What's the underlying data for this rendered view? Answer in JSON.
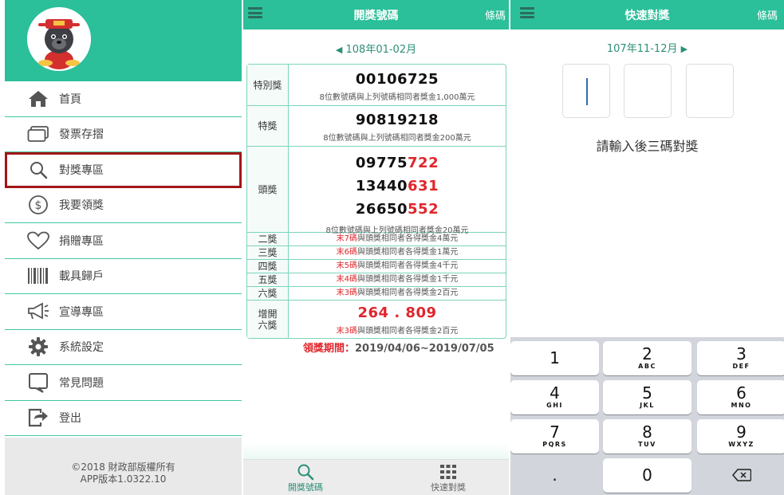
{
  "menu": {
    "items": [
      {
        "label": "首頁",
        "icon": "home-icon"
      },
      {
        "label": "發票存摺",
        "icon": "card-icon"
      },
      {
        "label": "對獎專區",
        "icon": "search-icon"
      },
      {
        "label": "我要領獎",
        "icon": "dollar-icon"
      },
      {
        "label": "捐贈專區",
        "icon": "heart-icon"
      },
      {
        "label": "載具歸戶",
        "icon": "barcode-icon"
      },
      {
        "label": "宣導專區",
        "icon": "megaphone-icon"
      },
      {
        "label": "系統設定",
        "icon": "gear-icon"
      },
      {
        "label": "常見問題",
        "icon": "question-icon"
      },
      {
        "label": "登出",
        "icon": "logout-icon"
      }
    ],
    "footer_copyright": "©2018 財政部版權所有",
    "footer_version": "APP版本1.0322.10"
  },
  "draw": {
    "title": "開獎號碼",
    "right_label": "條碼",
    "period": "108年01-02月",
    "prizes": {
      "special": {
        "label": "特別獎",
        "number": "00106725",
        "desc": "8位數號碼與上列號碼相同者獎金1,000萬元"
      },
      "grand": {
        "label": "特獎",
        "number": "90819218",
        "desc": "8位數號碼與上列號碼相同者獎金200萬元"
      },
      "first": {
        "label": "頭獎",
        "numbers": [
          {
            "head": "09775",
            "tail": "722"
          },
          {
            "head": "13440",
            "tail": "631"
          },
          {
            "head": "26650",
            "tail": "552"
          }
        ],
        "desc": "8位數號碼與上列號碼相同者獎金20萬元"
      },
      "lower": [
        {
          "label": "二獎",
          "red": "末7碼",
          "rest": "與頭獎相同者各得獎金4萬元"
        },
        {
          "label": "三獎",
          "red": "末6碼",
          "rest": "與頭獎相同者各得獎金1萬元"
        },
        {
          "label": "四獎",
          "red": "末5碼",
          "rest": "與頭獎相同者各得獎金4千元"
        },
        {
          "label": "五獎",
          "red": "末4碼",
          "rest": "與頭獎相同者各得獎金1千元"
        },
        {
          "label": "六獎",
          "red": "末3碼",
          "rest": "與頭獎相同者各得獎金2百元"
        }
      ],
      "extra": {
        "label_line1": "增開",
        "label_line2": "六獎",
        "numbers": "264 . 809",
        "red": "末3碼",
        "rest": "與頭獎相同者各得獎金2百元"
      }
    },
    "claim_label": "領獎期間：",
    "claim_period": "2019/04/06~2019/07/05",
    "nav": {
      "draw_label": "開獎號碼",
      "quick_label": "快速對獎"
    }
  },
  "quick": {
    "title": "快速對獎",
    "right_label": "條碼",
    "period": "107年11-12月",
    "prompt": "請輸入後三碼對獎",
    "keys": [
      {
        "num": "1",
        "letters": ""
      },
      {
        "num": "2",
        "letters": "ABC"
      },
      {
        "num": "3",
        "letters": "DEF"
      },
      {
        "num": "4",
        "letters": "GHI"
      },
      {
        "num": "5",
        "letters": "JKL"
      },
      {
        "num": "6",
        "letters": "MNO"
      },
      {
        "num": "7",
        "letters": "PQRS"
      },
      {
        "num": "8",
        "letters": "TUV"
      },
      {
        "num": "9",
        "letters": "WXYZ"
      },
      {
        "num": ".",
        "letters": ""
      },
      {
        "num": "0",
        "letters": ""
      }
    ]
  },
  "colors": {
    "brand": "#2bbf9a",
    "highlight_box": "#a31515",
    "accent_red": "#e0262c"
  }
}
